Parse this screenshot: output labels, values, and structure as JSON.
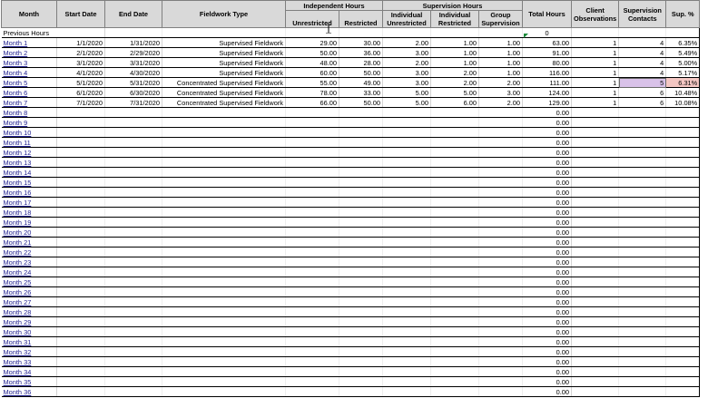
{
  "headers": {
    "month": "Month",
    "start_date": "Start Date",
    "end_date": "End Date",
    "fieldwork_type": "Fieldwork Type",
    "independent_group": "Independent Hours",
    "unrestricted": "Unrestricted",
    "restricted": "Restricted",
    "supervision_group": "Supervision Hours",
    "indiv_unrestricted_1": "Individual",
    "indiv_unrestricted_2": "Unrestricted",
    "indiv_restricted_1": "Individual",
    "indiv_restricted_2": "Restricted",
    "group_supervision_1": "Group",
    "group_supervision_2": "Supervision",
    "total_hours": "Total Hours",
    "client_obs_1": "Client",
    "client_obs_2": "Observations",
    "sup_contacts_1": "Supervision",
    "sup_contacts_2": "Contacts",
    "sup_pct": "Sup. %"
  },
  "previous_hours": {
    "label": "Previous Hours",
    "total": "0"
  },
  "rows": [
    {
      "month": "Month 1",
      "start": "1/1/2020",
      "end": "1/31/2020",
      "type": "Supervised Fieldwork",
      "unres": "29.00",
      "res": "30.00",
      "iu": "2.00",
      "ir": "1.00",
      "gs": "1.00",
      "total": "63.00",
      "obs": "1",
      "contacts": "4",
      "pct": "6.35%"
    },
    {
      "month": "Month 2",
      "start": "2/1/2020",
      "end": "2/29/2020",
      "type": "Supervised Fieldwork",
      "unres": "50.00",
      "res": "36.00",
      "iu": "3.00",
      "ir": "1.00",
      "gs": "1.00",
      "total": "91.00",
      "obs": "1",
      "contacts": "4",
      "pct": "5.49%"
    },
    {
      "month": "Month 3",
      "start": "3/1/2020",
      "end": "3/31/2020",
      "type": "Supervised Fieldwork",
      "unres": "48.00",
      "res": "28.00",
      "iu": "2.00",
      "ir": "1.00",
      "gs": "1.00",
      "total": "80.00",
      "obs": "1",
      "contacts": "4",
      "pct": "5.00%"
    },
    {
      "month": "Month 4",
      "start": "4/1/2020",
      "end": "4/30/2020",
      "type": "Supervised Fieldwork",
      "unres": "60.00",
      "res": "50.00",
      "iu": "3.00",
      "ir": "2.00",
      "gs": "1.00",
      "total": "116.00",
      "obs": "1",
      "contacts": "4",
      "pct": "5.17%"
    },
    {
      "month": "Month 5",
      "start": "5/1/2020",
      "end": "5/31/2020",
      "type": "Concentrated Supervised Fieldwork",
      "unres": "55.00",
      "res": "49.00",
      "iu": "3.00",
      "ir": "2.00",
      "gs": "2.00",
      "total": "111.00",
      "obs": "1",
      "contacts": "5",
      "pct": "6.31%"
    },
    {
      "month": "Month 6",
      "start": "6/1/2020",
      "end": "6/30/2020",
      "type": "Concentrated Supervised Fieldwork",
      "unres": "78.00",
      "res": "33.00",
      "iu": "5.00",
      "ir": "5.00",
      "gs": "3.00",
      "total": "124.00",
      "obs": "1",
      "contacts": "6",
      "pct": "10.48%"
    },
    {
      "month": "Month 7",
      "start": "7/1/2020",
      "end": "7/31/2020",
      "type": "Concentrated Supervised Fieldwork",
      "unres": "66.00",
      "res": "50.00",
      "iu": "5.00",
      "ir": "6.00",
      "gs": "2.00",
      "total": "129.00",
      "obs": "1",
      "contacts": "6",
      "pct": "10.08%"
    },
    {
      "month": "Month 8",
      "total": "0.00"
    },
    {
      "month": "Month 9",
      "total": "0.00"
    },
    {
      "month": "Month 10",
      "total": "0.00"
    },
    {
      "month": "Month 11",
      "total": "0.00"
    },
    {
      "month": "Month 12",
      "total": "0.00"
    },
    {
      "month": "Month 13",
      "total": "0.00"
    },
    {
      "month": "Month 14",
      "total": "0.00"
    },
    {
      "month": "Month 15",
      "total": "0.00"
    },
    {
      "month": "Month 16",
      "total": "0.00"
    },
    {
      "month": "Month 17",
      "total": "0.00"
    },
    {
      "month": "Month 18",
      "total": "0.00"
    },
    {
      "month": "Month 19",
      "total": "0.00"
    },
    {
      "month": "Month 20",
      "total": "0.00"
    },
    {
      "month": "Month 21",
      "total": "0.00"
    },
    {
      "month": "Month 22",
      "total": "0.00"
    },
    {
      "month": "Month 23",
      "total": "0.00"
    },
    {
      "month": "Month 24",
      "total": "0.00"
    },
    {
      "month": "Month 25",
      "total": "0.00"
    },
    {
      "month": "Month 26",
      "total": "0.00"
    },
    {
      "month": "Month 27",
      "total": "0.00"
    },
    {
      "month": "Month 28",
      "total": "0.00"
    },
    {
      "month": "Month 29",
      "total": "0.00"
    },
    {
      "month": "Month 30",
      "total": "0.00"
    },
    {
      "month": "Month 31",
      "total": "0.00"
    },
    {
      "month": "Month 32",
      "total": "0.00"
    },
    {
      "month": "Month 33",
      "total": "0.00"
    },
    {
      "month": "Month 34",
      "total": "0.00"
    },
    {
      "month": "Month 35",
      "total": "0.00"
    },
    {
      "month": "Month 36",
      "total": "0.00"
    }
  ],
  "selected_cell": {
    "row": "Month 5",
    "column": "Supervision Contacts"
  },
  "colors": {
    "header_bg": "#d9d9d9",
    "selected_bg": "#d9c2e9",
    "warning_bg": "#f4c7c3",
    "link": "#1f1f8f"
  }
}
